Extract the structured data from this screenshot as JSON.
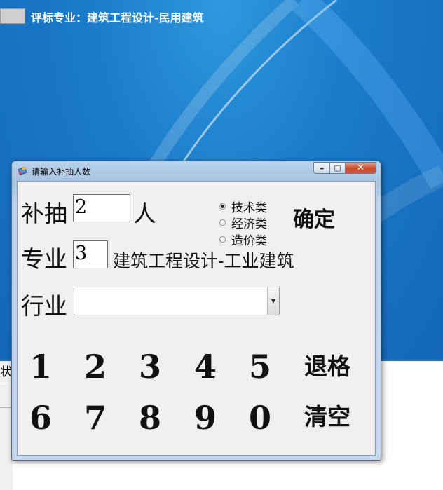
{
  "desktop": {
    "title": "评标专业：建筑工程设计-民用建筑",
    "left_fragment": "状"
  },
  "window": {
    "title": "请输入补抽人数",
    "buttons": {
      "minimize": "▬",
      "maximize": "▢",
      "close": "✕"
    }
  },
  "form": {
    "supplement_label": "补抽",
    "supplement_value": "2",
    "person_unit": "人",
    "major_label": "专业",
    "major_value": "3",
    "major_name": "建筑工程设计-工业建筑",
    "industry_label": "行业",
    "industry_value": "",
    "categories": [
      {
        "label": "技术类",
        "selected": true
      },
      {
        "label": "经济类",
        "selected": false
      },
      {
        "label": "造价类",
        "selected": false
      }
    ],
    "confirm_label": "确定"
  },
  "keypad": {
    "row1": [
      "1",
      "2",
      "3",
      "4",
      "5"
    ],
    "row2": [
      "6",
      "7",
      "8",
      "9",
      "0"
    ],
    "backspace_label": "退格",
    "clear_label": "清空"
  },
  "icons": {
    "window_icon": "app-icon",
    "dropdown": "chevron-down-icon"
  }
}
